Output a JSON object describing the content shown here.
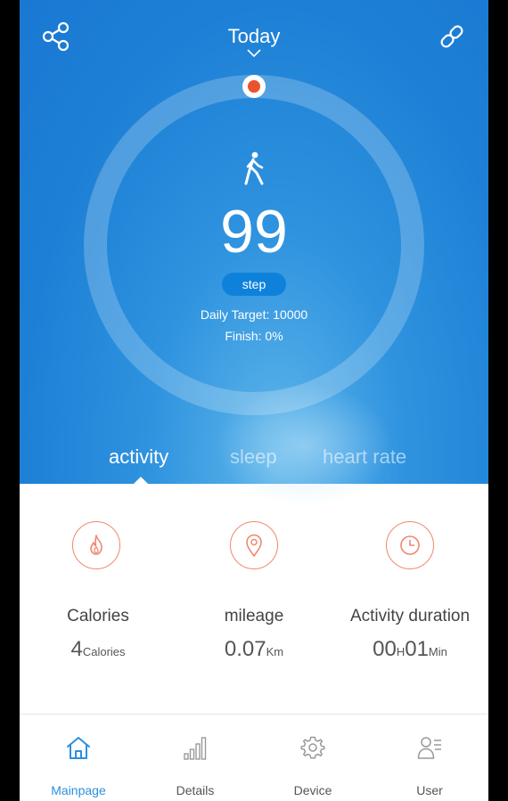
{
  "header": {
    "date_label": "Today"
  },
  "progress": {
    "steps": "99",
    "unit_label": "step",
    "daily_target": "Daily Target: 10000",
    "finish": "Finish: 0%",
    "fraction": 0.0099
  },
  "tabs": [
    {
      "label": "activity",
      "active": true
    },
    {
      "label": "sleep",
      "active": false
    },
    {
      "label": "heart rate",
      "active": false
    }
  ],
  "stats": {
    "calories": {
      "title": "Calories",
      "value": "4",
      "unit": "Calories",
      "icon": "flame-icon"
    },
    "mileage": {
      "title": "mileage",
      "value": "0.07",
      "unit": "Km",
      "icon": "location-pin-icon"
    },
    "duration": {
      "title": "Activity duration",
      "hours": "00",
      "hours_unit": "H",
      "minutes": "01",
      "minutes_unit": "Min",
      "icon": "clock-icon"
    }
  },
  "nav": [
    {
      "label": "Mainpage",
      "icon": "home-icon",
      "active": true
    },
    {
      "label": "Details",
      "icon": "bar-chart-icon",
      "active": false
    },
    {
      "label": "Device",
      "icon": "gear-icon",
      "active": false
    },
    {
      "label": "User",
      "icon": "user-list-icon",
      "active": false
    }
  ],
  "colors": {
    "hero_blue": "#1d80d6",
    "accent_orange": "#f0876e",
    "progress_dot": "#e9532d",
    "nav_active": "#2b8fe0"
  }
}
